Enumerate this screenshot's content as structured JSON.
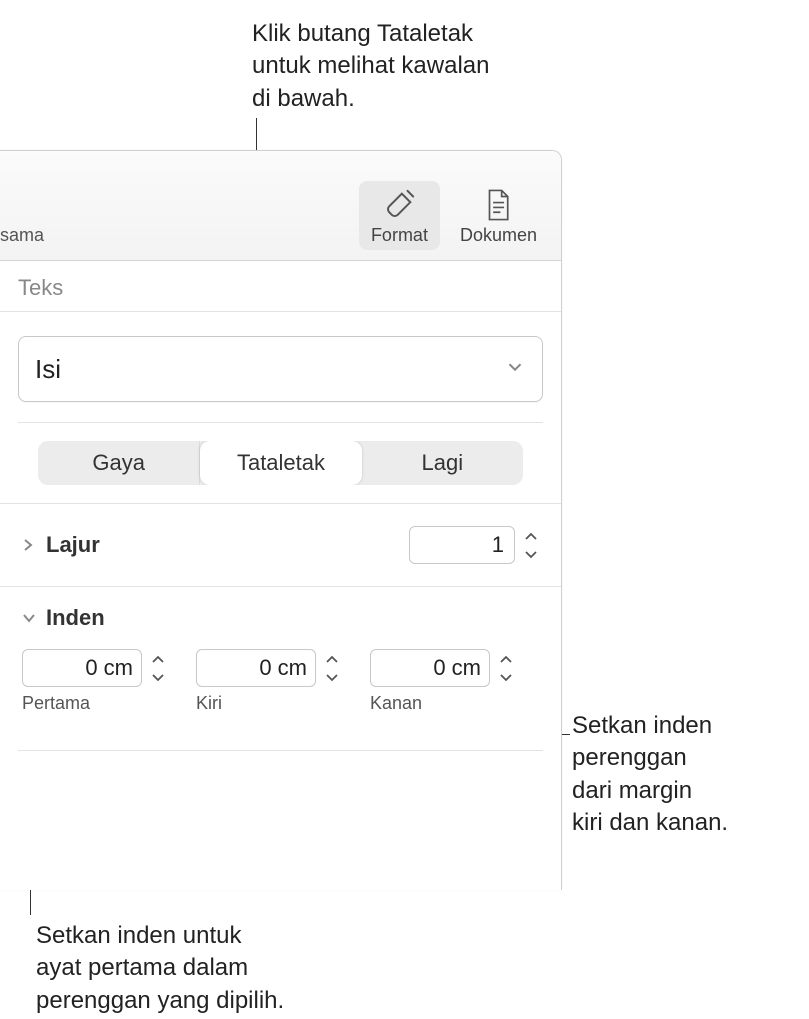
{
  "callouts": {
    "top": "Klik butang Tataletak\nuntuk melihat kawalan\ndi bawah.",
    "right": "Setkan inden\nperenggan\ndari margin\nkiri dan kanan.",
    "bottom": "Setkan inden untuk\nayat pertama dalam\nperenggan yang dipilih."
  },
  "toolbar": {
    "left_label": "sama",
    "format_label": "Format",
    "document_label": "Dokumen"
  },
  "section": {
    "title": "Teks"
  },
  "style_dropdown": {
    "value": "Isi"
  },
  "tabs": {
    "style": "Gaya",
    "layout": "Tataletak",
    "more": "Lagi"
  },
  "columns": {
    "label": "Lajur",
    "value": "1"
  },
  "indent": {
    "label": "Inden",
    "first": {
      "value": "0 cm",
      "label": "Pertama"
    },
    "left": {
      "value": "0 cm",
      "label": "Kiri"
    },
    "right": {
      "value": "0 cm",
      "label": "Kanan"
    }
  }
}
